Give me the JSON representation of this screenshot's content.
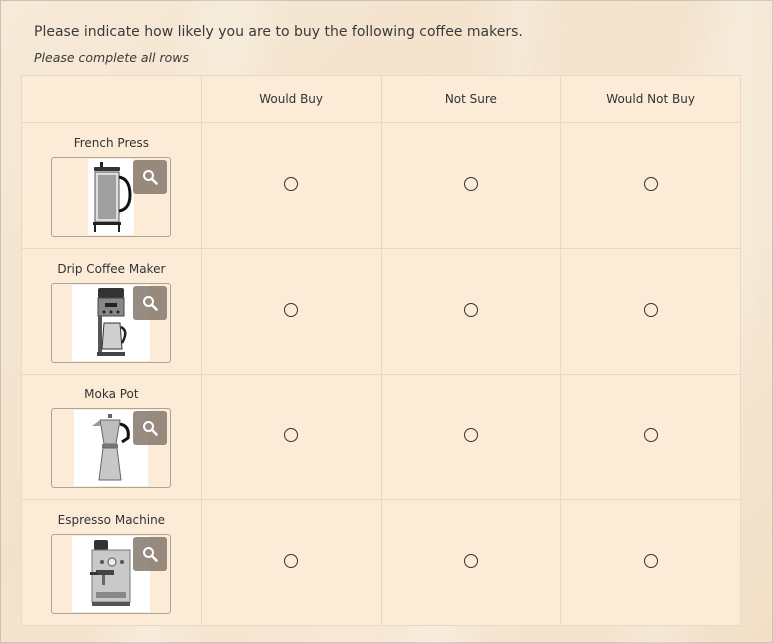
{
  "survey": {
    "question": "Please indicate how likely you are to buy the following coffee makers.",
    "instruction": "Please complete all rows",
    "columns": [
      "Would Buy",
      "Not Sure",
      "Would Not Buy"
    ],
    "rows": [
      {
        "label": "French Press",
        "icon": "french-press-image"
      },
      {
        "label": "Drip Coffee Maker",
        "icon": "drip-coffee-maker-image"
      },
      {
        "label": "Moka Pot",
        "icon": "moka-pot-image"
      },
      {
        "label": "Espresso Machine",
        "icon": "espresso-machine-image"
      }
    ]
  },
  "colors": {
    "background": "#f5e6d2",
    "cell": "#fcebd7",
    "cell_border": "#ead9c2",
    "zoom_button": "#8c8073"
  }
}
